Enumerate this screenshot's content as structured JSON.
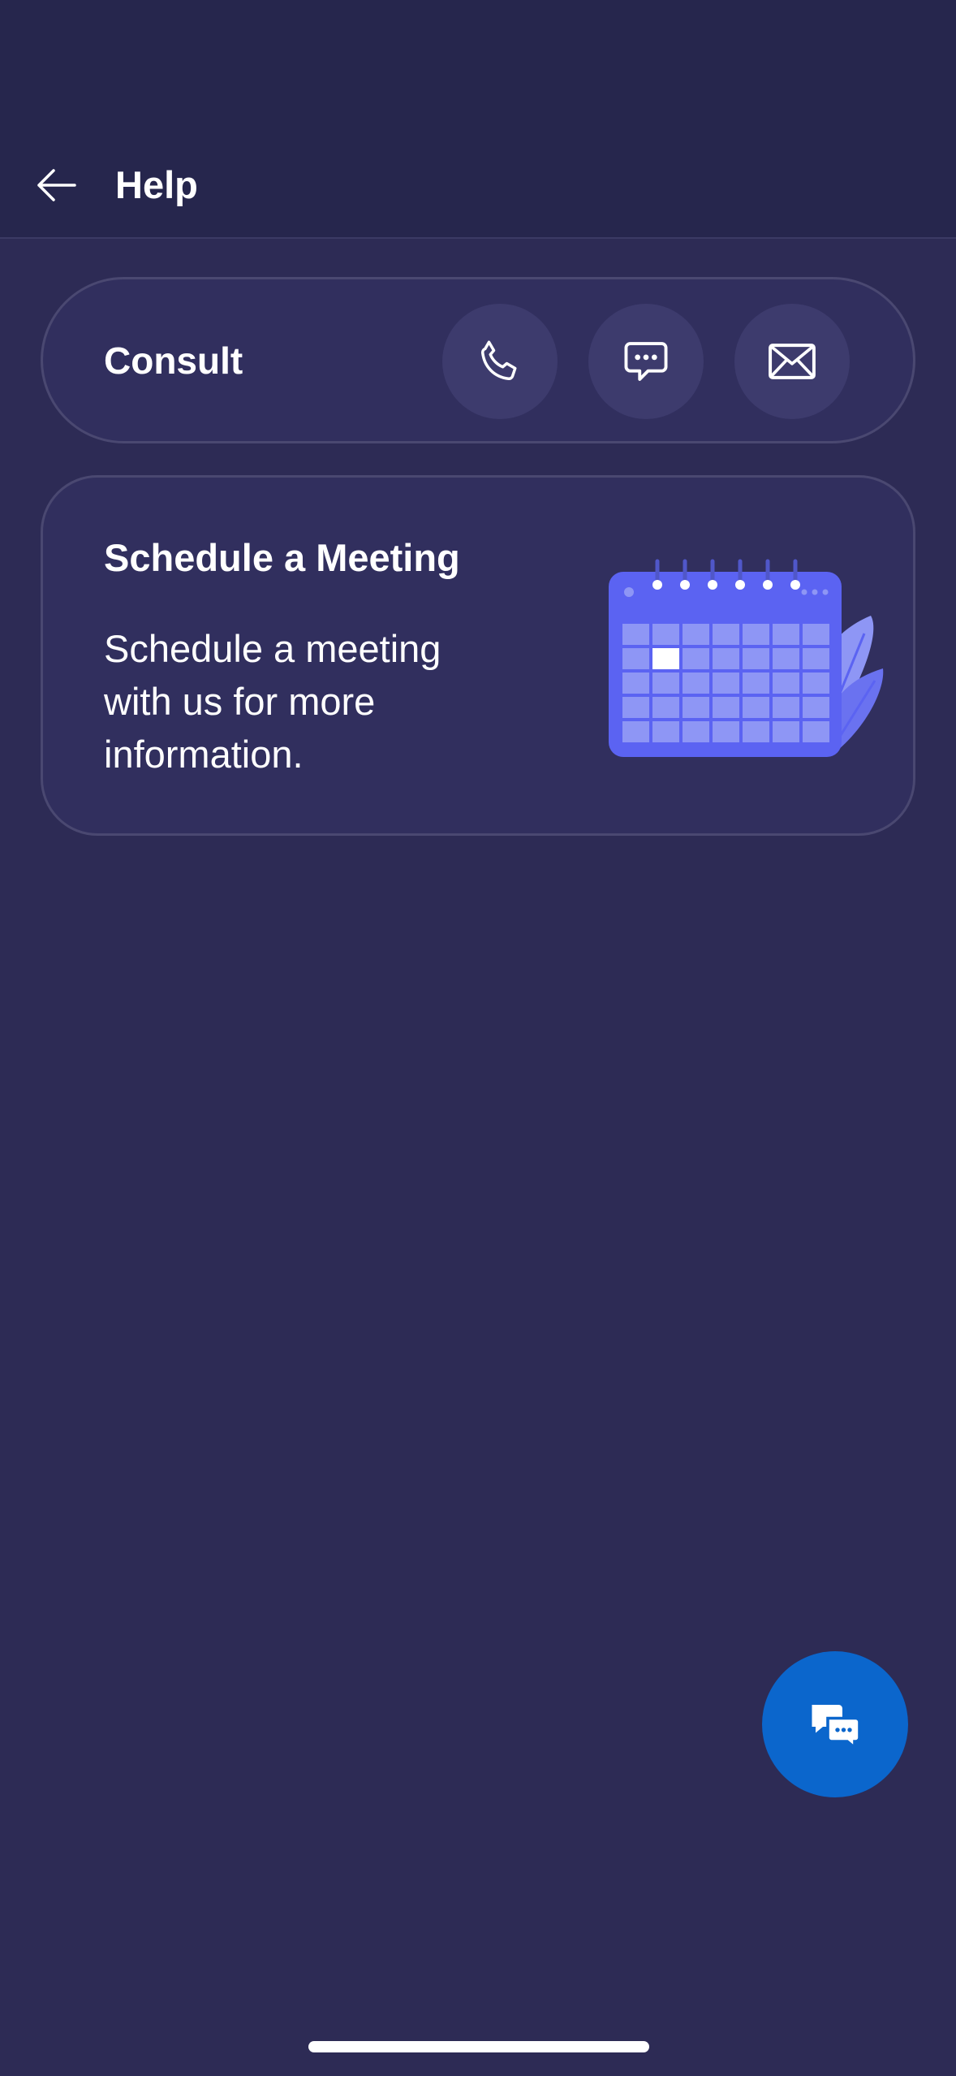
{
  "header": {
    "title": "Help",
    "back_icon": "arrow-left-icon"
  },
  "consult": {
    "label": "Consult",
    "actions": [
      {
        "name": "call",
        "icon": "phone-icon"
      },
      {
        "name": "chat",
        "icon": "chat-bubble-icon"
      },
      {
        "name": "email",
        "icon": "mail-icon"
      }
    ]
  },
  "meeting": {
    "title": "Schedule a Meeting",
    "description": "Schedule a meeting with us for more information.",
    "illustration": "calendar-illustration"
  },
  "fab": {
    "icon": "chat-bubbles-icon"
  },
  "colors": {
    "background": "#2d2b55",
    "header": "#26264d",
    "card": "#312f5e",
    "card_border": "#4a4871",
    "icon_button": "#3d3b6d",
    "fab": "#0b66cc",
    "calendar": "#5b63f2"
  }
}
